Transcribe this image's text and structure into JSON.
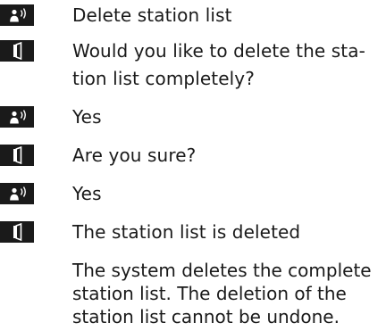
{
  "dialog": {
    "steps": [
      {
        "speaker": "user",
        "icon": "voice-command-icon",
        "lines": [
          "Delete station list"
        ]
      },
      {
        "speaker": "system",
        "icon": "system-response-icon",
        "lines": [
          "Would you like to delete the sta-",
          "tion list completely?"
        ]
      },
      {
        "speaker": "user",
        "icon": "voice-command-icon",
        "lines": [
          "Yes"
        ]
      },
      {
        "speaker": "system",
        "icon": "system-response-icon",
        "lines": [
          "Are you sure?"
        ]
      },
      {
        "speaker": "user",
        "icon": "voice-command-icon",
        "lines": [
          "Yes"
        ]
      },
      {
        "speaker": "system",
        "icon": "system-response-icon",
        "lines": [
          "The station list is deleted"
        ]
      }
    ],
    "note_lines": [
      "The system deletes the complete",
      "station list. The deletion of the",
      "station list cannot be undone."
    ]
  },
  "colors": {
    "icon_background": "#1a1a1a",
    "icon_foreground": "#ffffff",
    "text": "#1a1a1a"
  }
}
